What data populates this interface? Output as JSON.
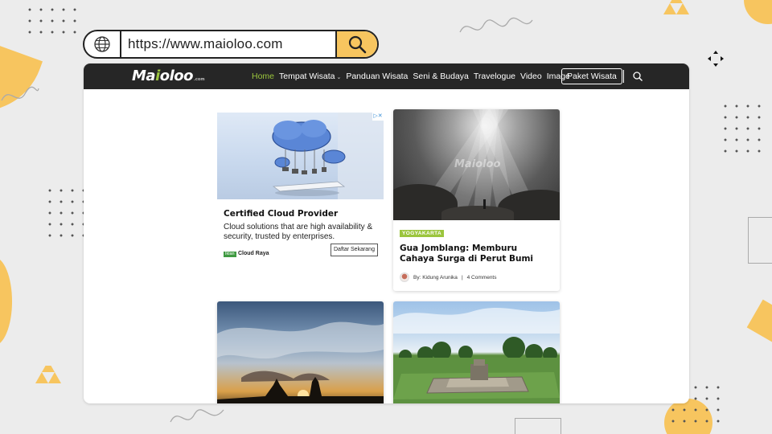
{
  "address_bar": {
    "url": "https://www.maioloo.com"
  },
  "site": {
    "logo_text_a": "Ma",
    "logo_text_o": "i",
    "logo_text_b": "oloo",
    "logo_suffix": ".com"
  },
  "nav": {
    "items": [
      "Home",
      "Tempat Wisata",
      "Panduan Wisata",
      "Seni & Budaya",
      "Travelogue",
      "Video",
      "Image"
    ],
    "button": "Paket Wisata"
  },
  "ad": {
    "badge": "▷✕",
    "title": "Certified Cloud Provider",
    "description": "Cloud solutions that are high availability & security, trusted by enterprises.",
    "tag": "Iklan",
    "brand": "Cloud Raya",
    "cta": "Daftar Sekarang"
  },
  "articles": [
    {
      "category": "YOGYAKARTA",
      "title": "Gua Jomblang: Memburu Cahaya Surga di Perut Bumi",
      "author": "By: Kidung Arunika",
      "divider": "|",
      "comments": "4 Comments",
      "watermark": "Maioloo"
    }
  ],
  "colors": {
    "accent_green": "#9bc53d",
    "nav_bg": "#262626",
    "deco_yellow": "#f7c55f"
  }
}
